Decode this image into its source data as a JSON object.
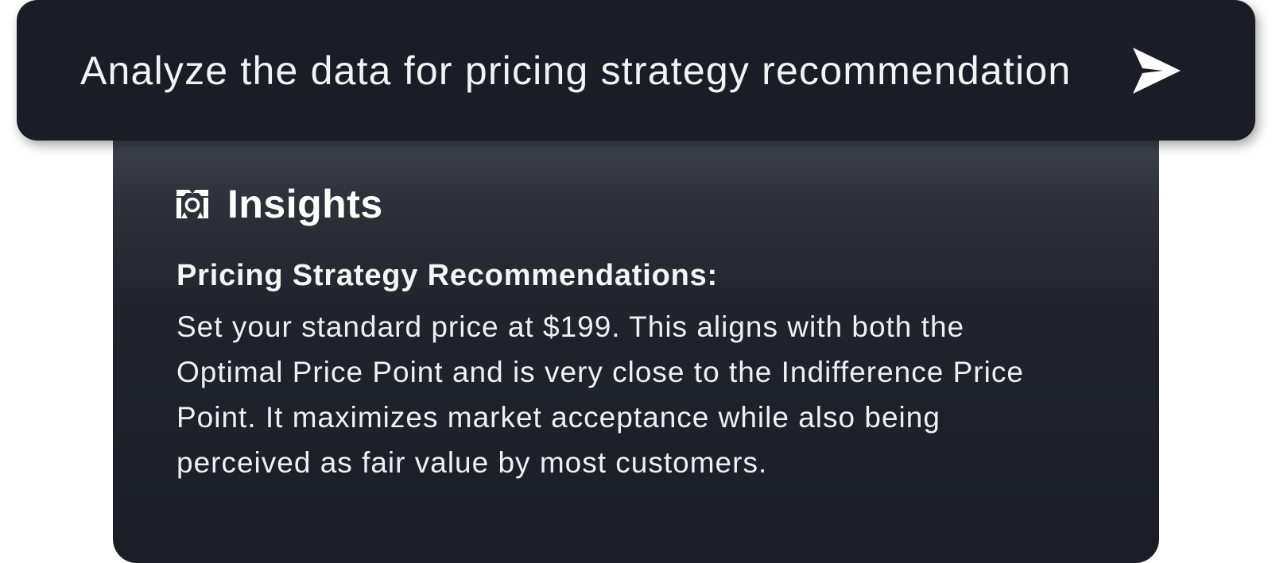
{
  "prompt": {
    "text": "Analyze the data for pricing strategy recommendation",
    "send_icon": "send-arrow-icon"
  },
  "insights": {
    "title": "Insights",
    "icon": "insights-logo-icon",
    "heading": "Pricing Strategy Recommendations:",
    "body": "Set your standard price at $199. This aligns with both the Optimal Price Point and is very close to the Indifference Price Point. It maximizes market acceptance while also being perceived as fair value by most customers."
  },
  "colors": {
    "prompt_bg": "#1a1d26",
    "card_top": "#434750",
    "card_bottom": "#1b1e26",
    "text": "#f2f3f5"
  }
}
